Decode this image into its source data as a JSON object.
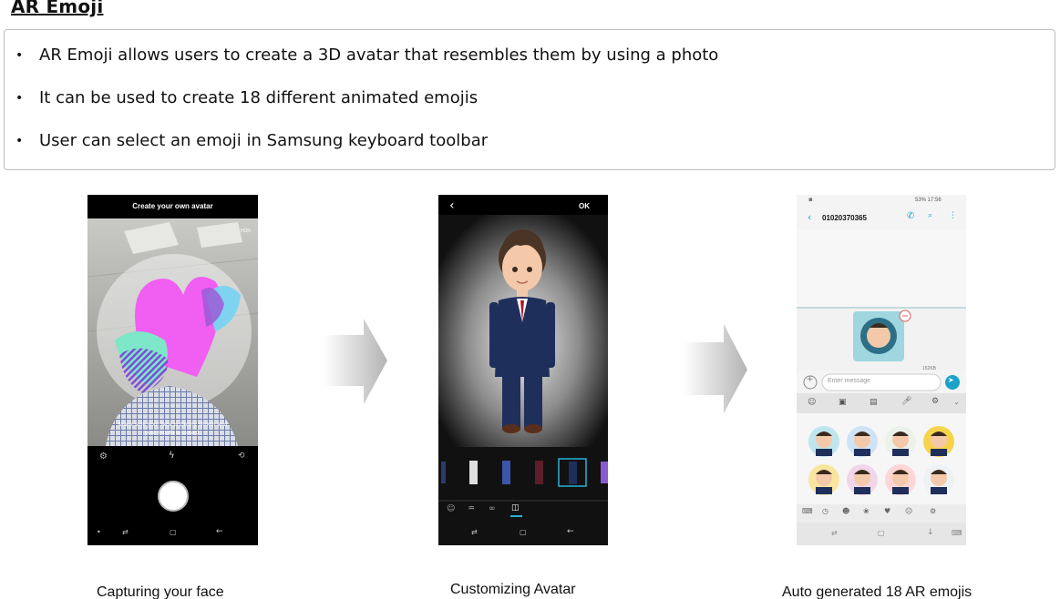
{
  "title": "AR Emoji",
  "bullets": [
    "AR Emoji allows users to create a 3D avatar that resembles them by using a photo",
    "It can be used to create 18 different animated emojis",
    "User can select an emoji in Samsung keyboard toolbar"
  ],
  "bullet_marker": "•",
  "screen1": {
    "header": "Create your own avatar",
    "hdr_badge": "HDR",
    "hint_line1": "Make sure your face is clearly shown and",
    "hint_line2": "your mouth is closed."
  },
  "screen2": {
    "back": "‹",
    "ok": "OK"
  },
  "screen3": {
    "status": "53% 17:56",
    "contact": "01020370365",
    "file_size": "152KB",
    "input_placeholder": "Enter message"
  },
  "captions": {
    "c1": "Capturing your face",
    "c2": "Customizing Avatar",
    "c3": "Auto generated 18 AR emojis"
  },
  "colors": {
    "accent_teal": "#1aa3c8",
    "suit_navy": "#1f2f5c"
  }
}
